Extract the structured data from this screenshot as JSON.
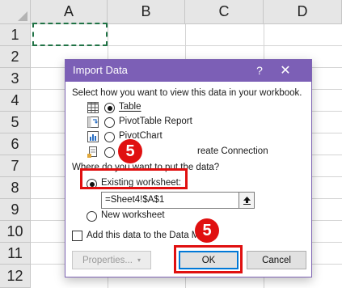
{
  "sheet": {
    "columns": [
      "A",
      "B",
      "C",
      "D"
    ],
    "rows": [
      "1",
      "2",
      "3",
      "4",
      "5",
      "6",
      "7",
      "8",
      "9",
      "10",
      "11",
      "12"
    ]
  },
  "dialog": {
    "title": "Import Data",
    "help_glyph": "?",
    "close_glyph": "✕",
    "prompt_view": "Select how you want to view this data in your workbook.",
    "view_options": [
      {
        "label": "Table",
        "selected": true,
        "icon": "table-icon"
      },
      {
        "label": "PivotTable Report",
        "selected": false,
        "icon": "pivottable-icon"
      },
      {
        "label": "PivotChart",
        "selected": false,
        "icon": "pivotchart-icon"
      },
      {
        "label": "reate Connection",
        "selected": false,
        "icon": "connection-icon"
      }
    ],
    "prompt_location": "Where do you want to put the data?",
    "existing_label": "Existing worksheet:",
    "existing_selected": true,
    "cell_reference": "=Sheet4!$A$1",
    "new_label": "New worksheet",
    "data_model_label": "Add this data to the Data M",
    "data_model_checked": false,
    "properties_label": "Properties...",
    "ok_label": "OK",
    "cancel_label": "Cancel"
  },
  "annotations": {
    "step_badge_1": "5",
    "step_badge_2": "5",
    "highlight_color": "#e01010"
  },
  "colors": {
    "title_bar": "#7c5fb6",
    "selection_marquee": "#217346"
  }
}
